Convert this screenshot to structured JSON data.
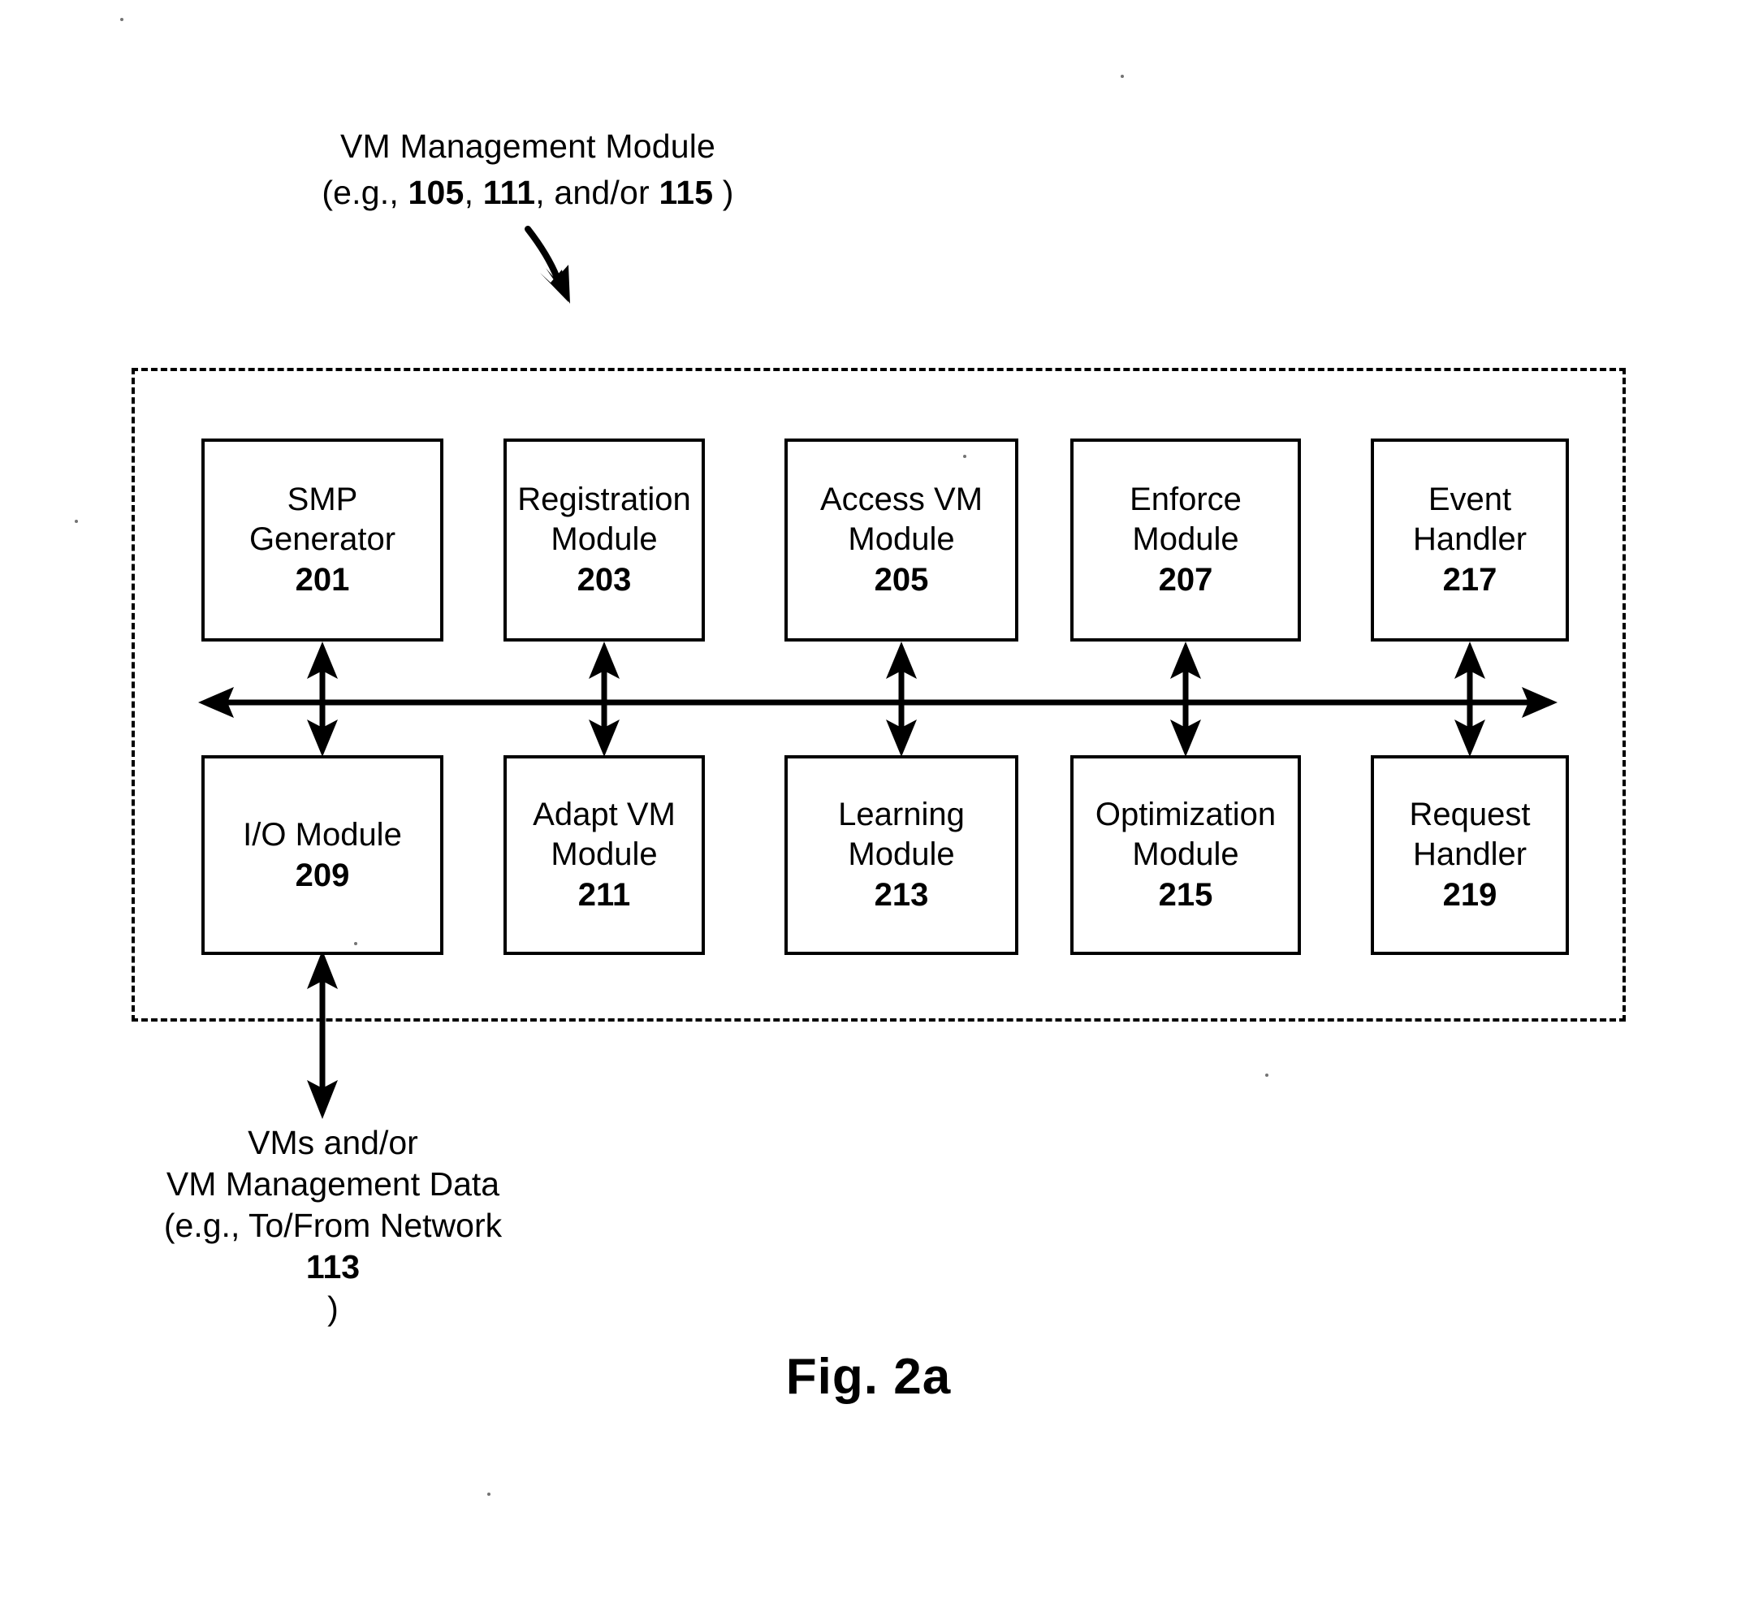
{
  "figure": {
    "caption": "Fig. 2a"
  },
  "title": {
    "line1": "VM Management Module",
    "line2_prefix": "(e.g., ",
    "ref1": "105",
    "sep1": ", ",
    "ref2": "111",
    "sep2": ", and/or ",
    "ref3": "115",
    "line2_suffix": " )"
  },
  "diagram": {
    "container_style": "dashed",
    "bus_label": "",
    "top_row": [
      {
        "label": "SMP\nGenerator",
        "number": "201"
      },
      {
        "label": "Registration\nModule",
        "number": "203"
      },
      {
        "label": "Access VM\nModule",
        "number": "205"
      },
      {
        "label": "Enforce\nModule",
        "number": "207"
      },
      {
        "label": "Event\nHandler",
        "number": "217"
      }
    ],
    "bottom_row": [
      {
        "label": "I/O Module",
        "number": "209"
      },
      {
        "label": "Adapt VM\nModule",
        "number": "211"
      },
      {
        "label": "Learning\nModule",
        "number": "213"
      },
      {
        "label": "Optimization\nModule",
        "number": "215"
      },
      {
        "label": "Request\nHandler",
        "number": "219"
      }
    ]
  },
  "bottom_caption": {
    "line1": "VMs and/or",
    "line2": "VM Management Data",
    "line3_prefix": "(e.g., To/From Network ",
    "line3_ref": "113",
    "line3_suffix": ")"
  },
  "colors": {
    "ink": "#000000",
    "paper": "#ffffff"
  }
}
